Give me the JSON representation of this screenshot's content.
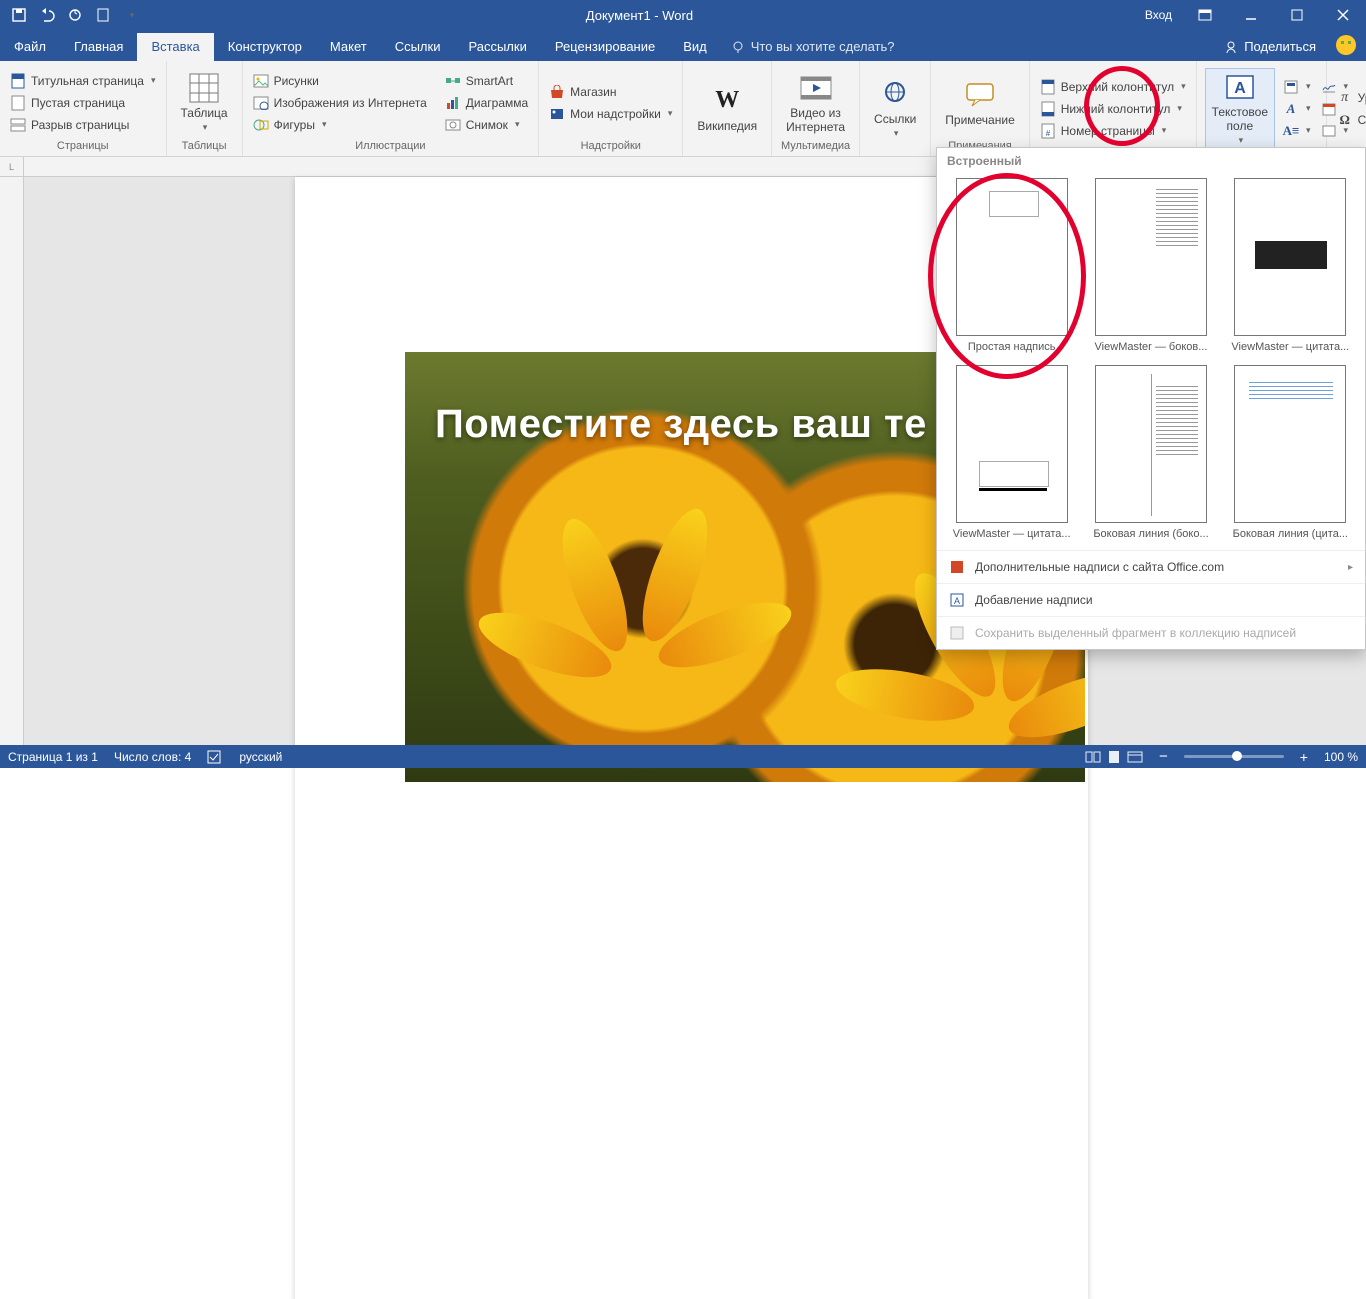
{
  "titlebar": {
    "title": "Документ1 - Word",
    "login": "Вход"
  },
  "tabs": {
    "file": "Файл",
    "home": "Главная",
    "insert": "Вставка",
    "design": "Конструктор",
    "layout": "Макет",
    "refs": "Ссылки",
    "mail": "Рассылки",
    "review": "Рецензирование",
    "view": "Вид",
    "tell": "Что вы хотите сделать?",
    "share": "Поделиться"
  },
  "ribbon": {
    "pages": {
      "cover": "Титульная страница",
      "blank": "Пустая страница",
      "break": "Разрыв страницы",
      "label": "Страницы"
    },
    "tables": {
      "table": "Таблица",
      "label": "Таблицы"
    },
    "illus": {
      "pic": "Рисунки",
      "online": "Изображения из Интернета",
      "shapes": "Фигуры",
      "smart": "SmartArt",
      "chart": "Диаграмма",
      "screen": "Снимок",
      "label": "Иллюстрации"
    },
    "addins": {
      "store": "Магазин",
      "my": "Мои надстройки",
      "label": "Надстройки"
    },
    "wiki": {
      "wiki": "Википедия"
    },
    "media": {
      "video": "Видео из Интернета",
      "label": "Мультимедиа"
    },
    "links": {
      "links": "Ссылки"
    },
    "comments": {
      "comment": "Примечание",
      "label": "Примечания"
    },
    "hf": {
      "header": "Верхний колонтитул",
      "footer": "Нижний колонтитул",
      "pageno": "Номер страницы"
    },
    "text": {
      "textbox": "Текстовое поле"
    },
    "symbols": {
      "eq": "Уравнение",
      "sym": "Символ"
    }
  },
  "gallery": {
    "head": "Встроенный",
    "items": [
      "Простая надпись",
      "ViewMaster — боков...",
      "ViewMaster — цитата...",
      "ViewMaster — цитата...",
      "Боковая линия (боко...",
      "Боковая линия (цита..."
    ],
    "more": "Дополнительные надписи с сайта Office.com",
    "draw": "Добавление надписи",
    "save": "Сохранить выделенный фрагмент в коллекцию надписей"
  },
  "doc": {
    "overlay": "Поместите здесь ваш те"
  },
  "status": {
    "page": "Страница 1 из 1",
    "words": "Число слов: 4",
    "lang": "русский",
    "zoom": "100 %"
  }
}
